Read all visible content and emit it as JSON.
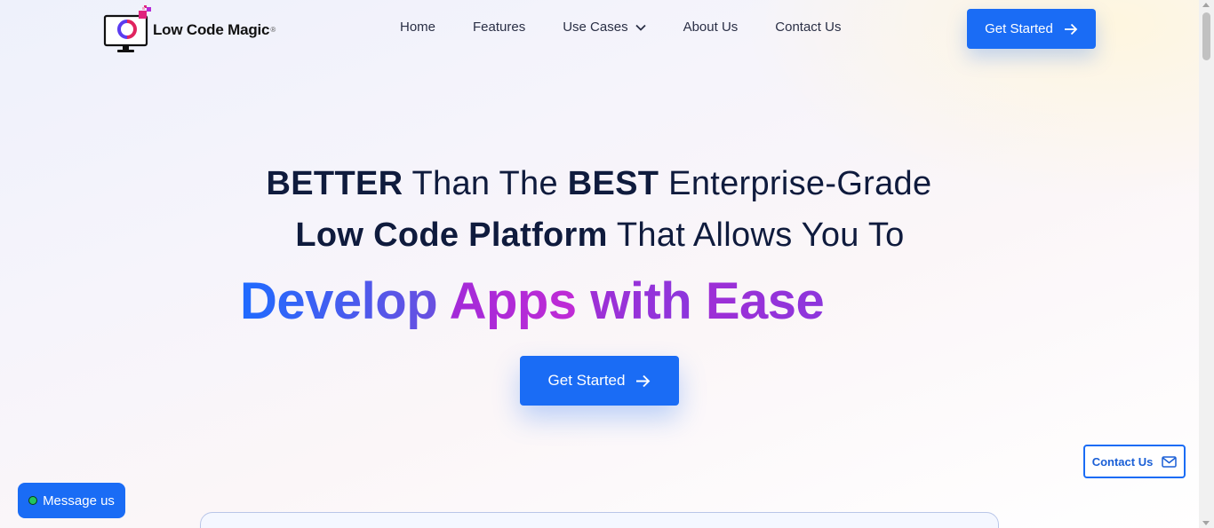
{
  "brand": {
    "name": "Low Code Magic",
    "registered_mark": "®",
    "logo_icon": "monitor-logo-icon"
  },
  "nav": {
    "items": [
      {
        "label": "Home",
        "has_dropdown": false
      },
      {
        "label": "Features",
        "has_dropdown": false
      },
      {
        "label": "Use Cases",
        "has_dropdown": true
      },
      {
        "label": "About Us",
        "has_dropdown": false
      },
      {
        "label": "Contact Us",
        "has_dropdown": false
      }
    ]
  },
  "header": {
    "cta_label": "Get Started"
  },
  "hero": {
    "line1": {
      "bold1": "BETTER",
      "light1": " Than The ",
      "bold2": "BEST",
      "light2": " Enterprise-Grade"
    },
    "line2": {
      "bold": "Low Code Platform",
      "light": " That Allows You To"
    },
    "animated": {
      "word1": "Develop",
      "word2": "Apps",
      "word3": "with",
      "word4": "Ease"
    },
    "cta_label": "Get Started"
  },
  "floating": {
    "contact_label": "Contact Us",
    "message_label": "Message us"
  },
  "colors": {
    "primary": "#1a6cf5",
    "heading": "#0f1b3d",
    "gradient_blue": "#1f6bff",
    "gradient_magenta": "#c02bd6",
    "gradient_purple": "#8d36dc"
  }
}
